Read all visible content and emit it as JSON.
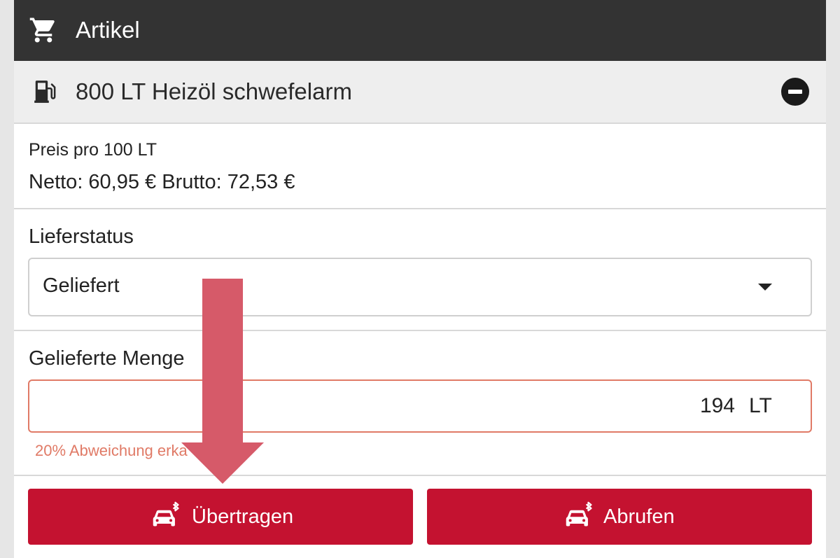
{
  "header": {
    "title": "Artikel",
    "icon": "cart-icon"
  },
  "item": {
    "name": "800 LT Heizöl schwefelarm",
    "icon": "fuel-pump-icon",
    "collapse_icon": "minus-circle-icon"
  },
  "price": {
    "label": "Preis pro 100 LT",
    "values": "Netto: 60,95 € Brutto: 72,53 €"
  },
  "delivery_status": {
    "label": "Lieferstatus",
    "selected": "Geliefert"
  },
  "delivered_quantity": {
    "label": "Gelieferte Menge",
    "value": "194",
    "unit": "LT",
    "hint": "20% Abweichung erka"
  },
  "actions": {
    "transfer_label": "Übertragen",
    "fetch_label": "Abrufen",
    "icon": "truck-bluetooth-icon"
  },
  "colors": {
    "header_bg": "#333333",
    "accent_red": "#c41230",
    "warning": "#e07a66",
    "annotation_arrow": "#d65a69"
  }
}
